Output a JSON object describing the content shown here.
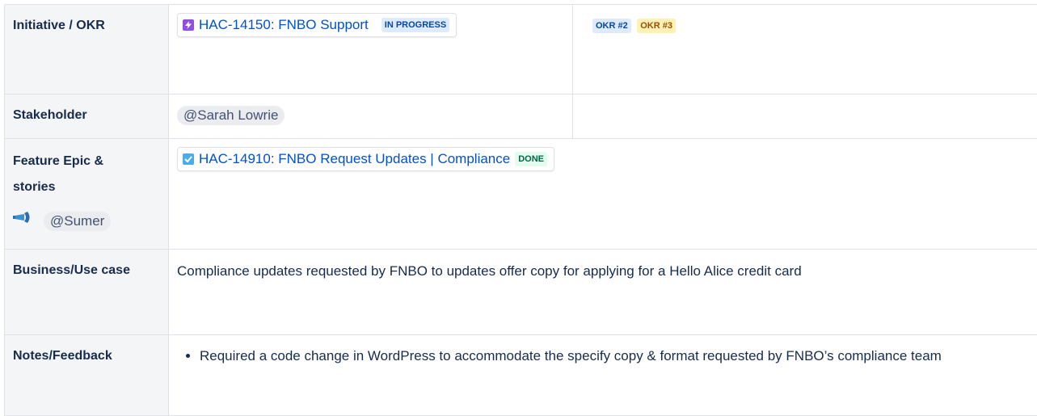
{
  "rows": {
    "initiative": {
      "label": "Initiative / OKR",
      "issue_key_title": "HAC-14150: FNBO Support",
      "status": "IN PROGRESS",
      "okr_1": "OKR #2",
      "okr_2": "OKR #3"
    },
    "stakeholder": {
      "label": "Stakeholder",
      "mention": "@Sarah Lowrie"
    },
    "feature": {
      "label": "Feature Epic & stories",
      "owner_mention": "@Sumer",
      "owner_icon": "megaphone-icon",
      "issue_key_title": "HAC-14910: FNBO Request Updates | Compliance",
      "status": "DONE"
    },
    "business": {
      "label": "Business/Use case",
      "text": "Compliance updates requested by FNBO to updates offer copy for applying for a Hello Alice credit card"
    },
    "notes": {
      "label": "Notes/Feedback",
      "bullets": [
        "Required a code change in WordPress to accommodate the specify copy & format requested by FNBO’s compliance team"
      ]
    }
  },
  "colors": {
    "header_bg": "#f4f5f7",
    "border": "#dfe1e6",
    "link": "#0052cc",
    "epic_purple": "#904ee2",
    "task_blue": "#4bade8"
  }
}
